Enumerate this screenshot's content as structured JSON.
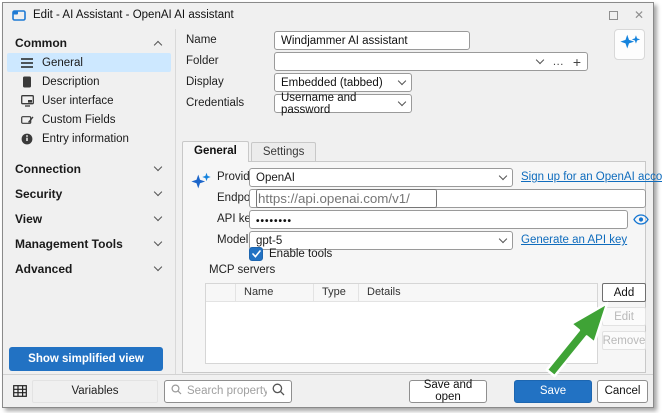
{
  "window": {
    "title": "Edit - AI Assistant - OpenAI AI assistant"
  },
  "icons": {
    "titlebar": "overlapping-windows-icon",
    "maximize": "maximize-square",
    "close": "✕",
    "folder_ellipsis": "…",
    "folder_add": "+"
  },
  "sidebar": {
    "sections": [
      {
        "label": "Common",
        "expanded": true,
        "items": [
          {
            "icon": "menu-icon",
            "label": "General",
            "selected": true
          },
          {
            "icon": "description-icon",
            "label": "Description",
            "selected": false
          },
          {
            "icon": "monitor-icon",
            "label": "User interface",
            "selected": false
          },
          {
            "icon": "custom-fields-icon",
            "label": "Custom Fields",
            "selected": false
          },
          {
            "icon": "info-icon",
            "label": "Entry information",
            "selected": false
          }
        ]
      },
      {
        "label": "Connection",
        "expanded": false
      },
      {
        "label": "Security",
        "expanded": false
      },
      {
        "label": "View",
        "expanded": false
      },
      {
        "label": "Management Tools",
        "expanded": false
      },
      {
        "label": "Advanced",
        "expanded": false
      }
    ],
    "show_simplified_view_label": "Show simplified view"
  },
  "form": {
    "name": {
      "label": "Name",
      "value": "Windjammer AI assistant"
    },
    "folder": {
      "label": "Folder",
      "value": ""
    },
    "display": {
      "label": "Display",
      "value": "Embedded (tabbed)"
    },
    "credentials": {
      "label": "Credentials",
      "value": "Username and password"
    }
  },
  "tabs": {
    "items": [
      {
        "label": "General",
        "active": true
      },
      {
        "label": "Settings",
        "active": false
      }
    ]
  },
  "ai": {
    "provider": {
      "label": "Provider",
      "value": "OpenAI"
    },
    "signup_link": "Sign up for an OpenAI account",
    "endpoint": {
      "label": "Endpoint",
      "placeholder": "https://api.openai.com/v1/"
    },
    "api_key": {
      "label": "API key",
      "value": "••••••••"
    },
    "model": {
      "label": "Model",
      "value": "gpt-5"
    },
    "generate_link": "Generate an API key",
    "enable_tools": {
      "label": "Enable tools",
      "checked": true
    },
    "mcp": {
      "label": "MCP servers",
      "columns": [
        "Name",
        "Type",
        "Details"
      ],
      "rows": [],
      "add_label": "Add",
      "edit_label": "Edit",
      "remove_label": "Remove"
    }
  },
  "footer": {
    "variables": "Variables",
    "search_placeholder": "Search property",
    "save_and_open": "Save and open",
    "save": "Save",
    "cancel": "Cancel"
  },
  "colors": {
    "accent_blue": "#2272c3",
    "link_blue": "#0f6cbd",
    "selection_blue": "#cde8ff",
    "sparkle_blue": "#1583dd",
    "arrow_green": "#3fa336"
  }
}
